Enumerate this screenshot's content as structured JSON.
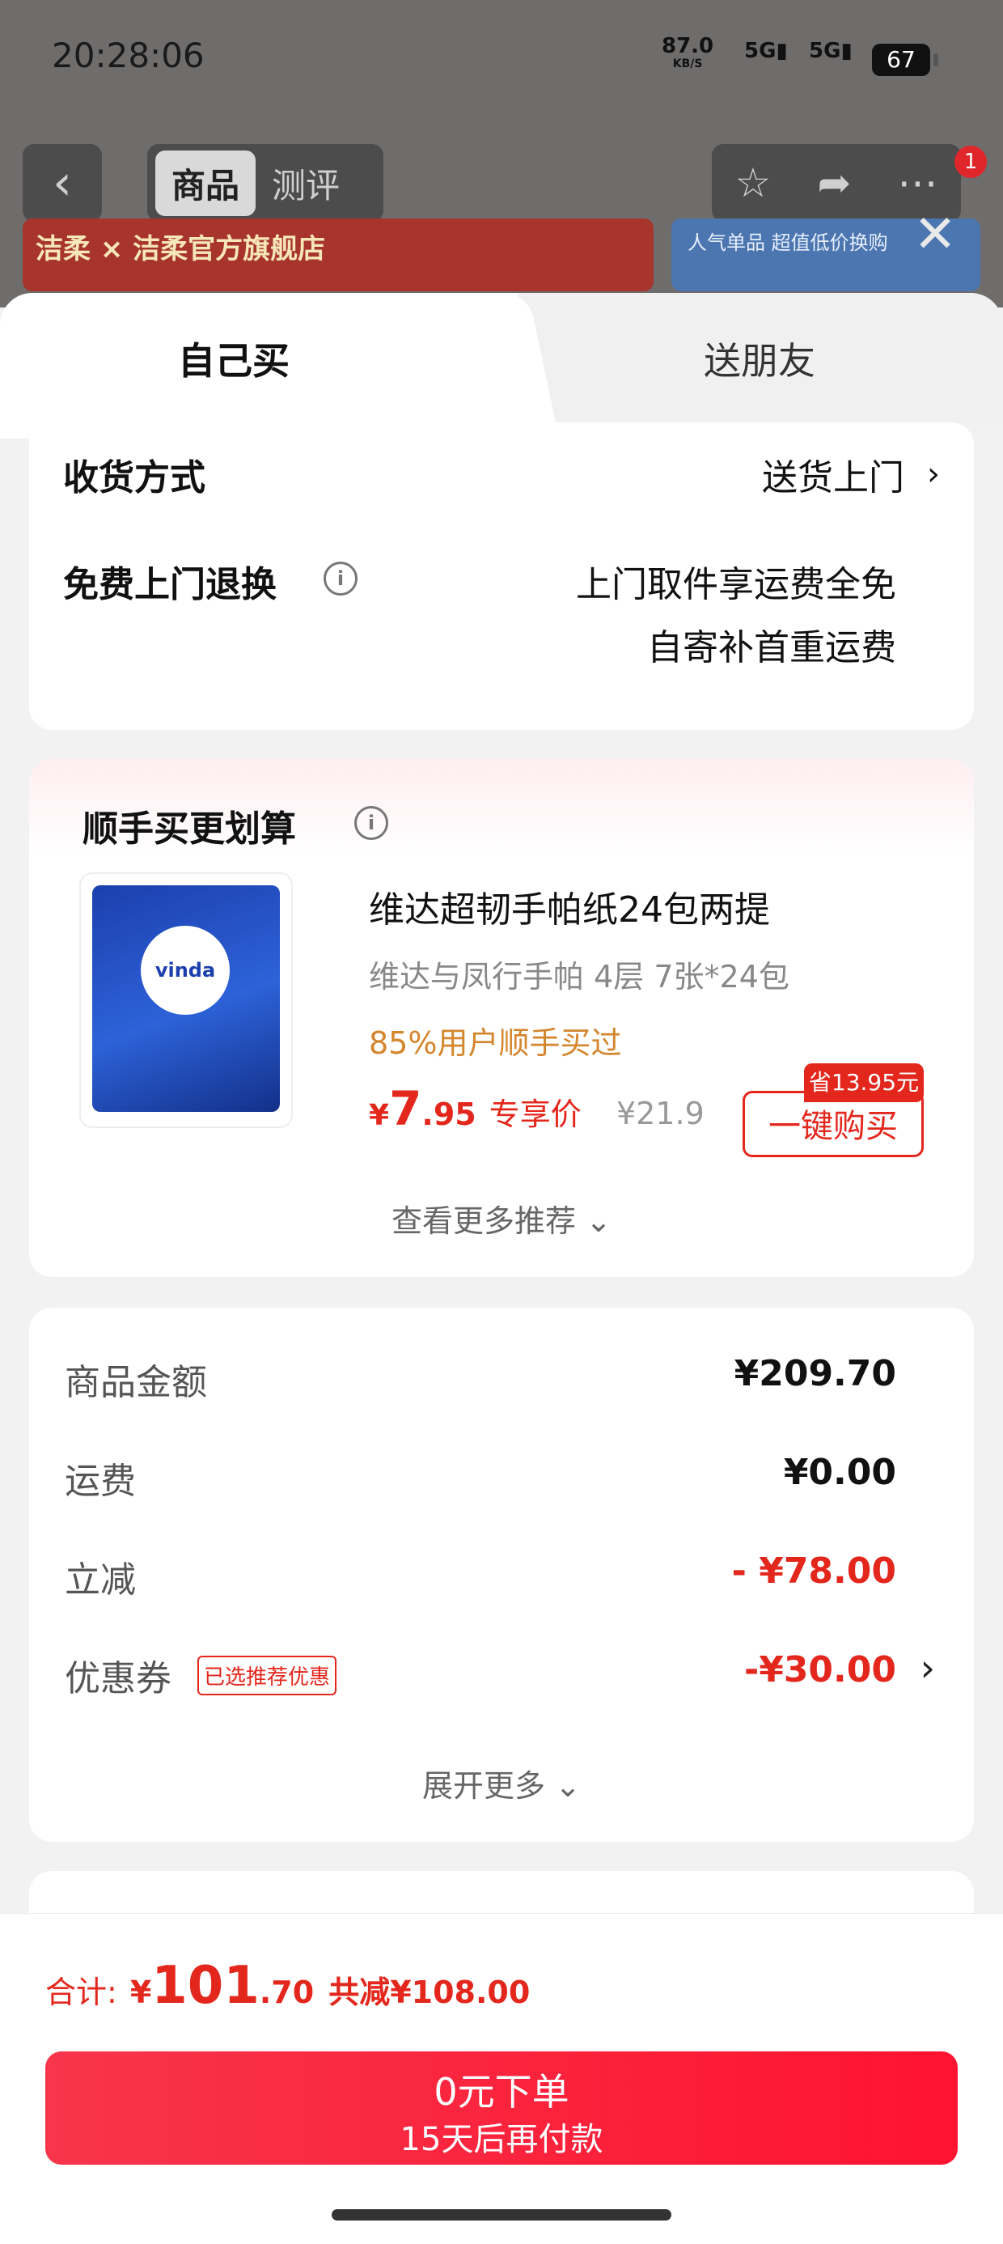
{
  "status_bar": {
    "time": "20:28:06",
    "net_speed": "87.0",
    "net_unit": "KB/S",
    "signal_1": "5G",
    "signal_2": "5G",
    "battery": "67"
  },
  "product_header": {
    "tab_active": "商品",
    "tab_inactive": "测评",
    "badge_count": "1",
    "banner_left_text": "洁柔 × 洁柔官方旗舰店",
    "banner_right_text": "人气单品 超值低价换购"
  },
  "sheet_tabs": {
    "self_buy": "自己买",
    "gift": "送朋友"
  },
  "delivery": {
    "method_label": "收货方式",
    "method_value": "送货上门",
    "return_label": "免费上门退换",
    "return_line1": "上门取件享运费全免",
    "return_line2": "自寄补首重运费"
  },
  "addon": {
    "title": "顺手买更划算",
    "product_title": "维达超韧手帕纸24包两提",
    "product_sub": "维达与凤行手帕 4层 7张*24包",
    "social_proof": "85%用户顺手买过",
    "price_yen": "¥",
    "price_int": "7",
    "price_dec": ".95",
    "price_tag": "专享价",
    "original_price": "¥21.9",
    "save_badge": "省13.95元",
    "buy_button": "一键购买",
    "more_recommend": "查看更多推荐 ⌄",
    "image_logo_text": "vinda"
  },
  "fees": {
    "items": [
      {
        "label": "商品金额",
        "value": "¥209.70"
      },
      {
        "label": "运费",
        "value": "¥0.00"
      },
      {
        "label": "立减",
        "value": "- ¥78.00"
      },
      {
        "label": "优惠券",
        "value": "-¥30.00"
      }
    ],
    "coupon_tag": "已选推荐优惠",
    "expand_more": "展开更多 ⌄"
  },
  "bottom": {
    "total_label": "合计:",
    "total_yen": "¥",
    "total_int": "101",
    "total_dec": ".70",
    "total_discount": "共减¥108.00",
    "order_main": "0元下单",
    "order_sub": "15天后再付款"
  },
  "colors": {
    "accent_red": "#e3271d",
    "button_red": "#fe1330",
    "social_orange": "#d4862c"
  }
}
